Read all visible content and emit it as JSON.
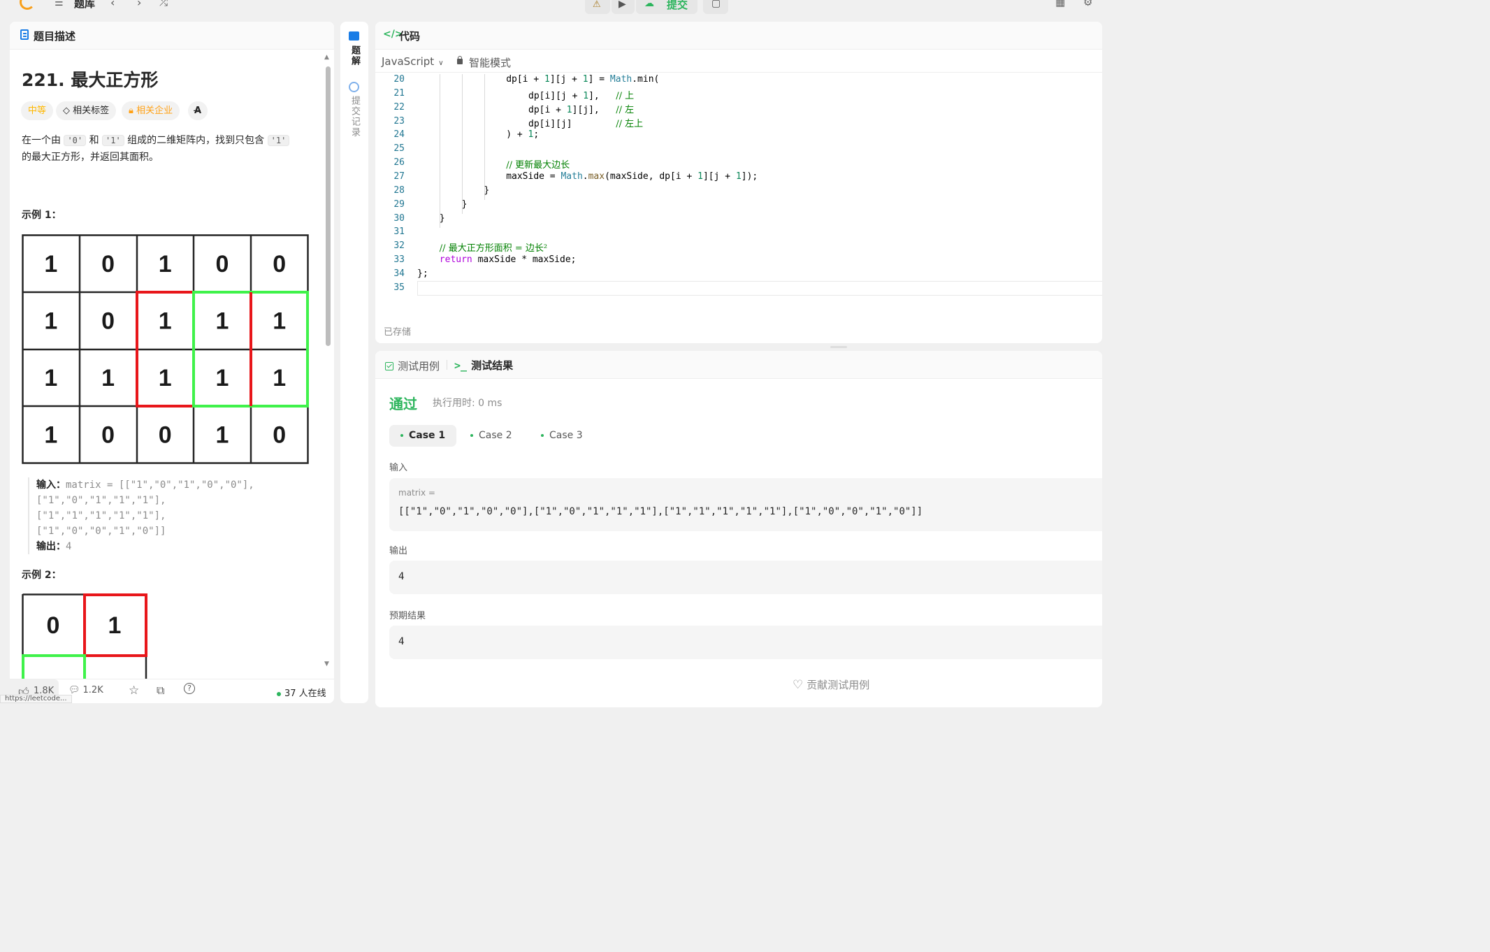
{
  "topbar": {
    "problems_label": "题库",
    "submit_label": "提交"
  },
  "description_panel": {
    "header": "题目描述",
    "title": "221. 最大正方形",
    "tags": {
      "difficulty": "中等",
      "topics": "相关标签",
      "companies": "相关企业",
      "lang_toggle": "A̶"
    },
    "desc_part1": "在一个由 ",
    "desc_code1": "'0'",
    "desc_part2": " 和 ",
    "desc_code2": "'1'",
    "desc_part3": " 组成的二维矩阵内，找到只包含 ",
    "desc_code3": "'1'",
    "desc_part4": "的最大正方形，并返回其面积。",
    "example1": {
      "title": "示例 1：",
      "matrix": [
        [
          "1",
          "0",
          "1",
          "0",
          "0"
        ],
        [
          "1",
          "0",
          "1",
          "1",
          "1"
        ],
        [
          "1",
          "1",
          "1",
          "1",
          "1"
        ],
        [
          "1",
          "0",
          "0",
          "1",
          "0"
        ]
      ],
      "input_label": "输入：",
      "input_lines": [
        "matrix = [[\"1\",\"0\",\"1\",\"0\",\"0\"],",
        "[\"1\",\"0\",\"1\",\"1\",\"1\"],",
        "[\"1\",\"1\",\"1\",\"1\",\"1\"],",
        "[\"1\",\"0\",\"0\",\"1\",\"0\"]]"
      ],
      "output_label": "输出：",
      "output": "4"
    },
    "example2": {
      "title": "示例 2：",
      "matrix": [
        [
          "0",
          "1"
        ]
      ]
    },
    "footer": {
      "likes": "1.8K",
      "comments": "1.2K",
      "online": "37 人在线"
    },
    "url_hint": "https://leetcode..."
  },
  "side_rail": {
    "solutions": "题解",
    "submissions": "提交记录"
  },
  "code_panel": {
    "header": "代码",
    "language": "JavaScript",
    "mode": "智能模式",
    "saved": "已存储",
    "lines": [
      {
        "n": "20",
        "indent": 16,
        "code": [
          [
            "dp[i + ",
            "p"
          ],
          [
            "1",
            "num"
          ],
          [
            "][j + ",
            "p"
          ],
          [
            "1",
            "num"
          ],
          [
            "] = ",
            "p"
          ],
          [
            "Math",
            "obj"
          ],
          [
            ".min(",
            "p"
          ]
        ]
      },
      {
        "n": "21",
        "indent": 20,
        "code": [
          [
            "dp[i][j + ",
            "p"
          ],
          [
            "1",
            "num"
          ],
          [
            "],   ",
            "p"
          ],
          [
            "// 上",
            "cm"
          ]
        ]
      },
      {
        "n": "22",
        "indent": 20,
        "code": [
          [
            "dp[i + ",
            "p"
          ],
          [
            "1",
            "num"
          ],
          [
            "][j],   ",
            "p"
          ],
          [
            "// 左",
            "cm"
          ]
        ]
      },
      {
        "n": "23",
        "indent": 20,
        "code": [
          [
            "dp[i][j]        ",
            "p"
          ],
          [
            "// 左上",
            "cm"
          ]
        ]
      },
      {
        "n": "24",
        "indent": 16,
        "code": [
          [
            ") + ",
            "p"
          ],
          [
            "1",
            "num"
          ],
          [
            ";",
            "p"
          ]
        ]
      },
      {
        "n": "25",
        "indent": 0,
        "code": []
      },
      {
        "n": "26",
        "indent": 16,
        "code": [
          [
            "// 更新最大边长",
            "cm"
          ]
        ]
      },
      {
        "n": "27",
        "indent": 16,
        "code": [
          [
            "maxSide = ",
            "p"
          ],
          [
            "Math",
            "obj"
          ],
          [
            ".",
            "p"
          ],
          [
            "max",
            "fn"
          ],
          [
            "(maxSide, dp[i + ",
            "p"
          ],
          [
            "1",
            "num"
          ],
          [
            "][j + ",
            "p"
          ],
          [
            "1",
            "num"
          ],
          [
            "]);",
            "p"
          ]
        ]
      },
      {
        "n": "28",
        "indent": 12,
        "code": [
          [
            "}",
            "p"
          ]
        ]
      },
      {
        "n": "29",
        "indent": 8,
        "code": [
          [
            "}",
            "p"
          ]
        ]
      },
      {
        "n": "30",
        "indent": 4,
        "code": [
          [
            "}",
            "p"
          ]
        ]
      },
      {
        "n": "31",
        "indent": 0,
        "code": []
      },
      {
        "n": "32",
        "indent": 4,
        "code": [
          [
            "// 最大正方形面积 = 边长²",
            "cm"
          ]
        ]
      },
      {
        "n": "33",
        "indent": 4,
        "code": [
          [
            "return",
            "kw"
          ],
          [
            " maxSide * maxSide;",
            "p"
          ]
        ]
      },
      {
        "n": "34",
        "indent": 0,
        "code": [
          [
            "};",
            "p"
          ]
        ]
      },
      {
        "n": "35",
        "indent": 0,
        "code": []
      }
    ]
  },
  "test_panel": {
    "tab_cases": "测试用例",
    "tab_results": "测试结果",
    "status": "通过",
    "runtime": "执行用时: 0 ms",
    "cases": [
      "Case 1",
      "Case 2",
      "Case 3"
    ],
    "input_label": "输入",
    "input_name": "matrix =",
    "input_value": "[[\"1\",\"0\",\"1\",\"0\",\"0\"],[\"1\",\"0\",\"1\",\"1\",\"1\"],[\"1\",\"1\",\"1\",\"1\",\"1\"],[\"1\",\"0\",\"0\",\"1\",\"0\"]]",
    "output_label": "输出",
    "output_value": "4",
    "expected_label": "预期结果",
    "expected_value": "4",
    "contribute": "贡献测试用例"
  },
  "colors": {
    "accent_green": "#2db55d",
    "highlight_red": "#e8161a",
    "highlight_green": "#3ff24a",
    "difficulty": "#ffb800"
  }
}
